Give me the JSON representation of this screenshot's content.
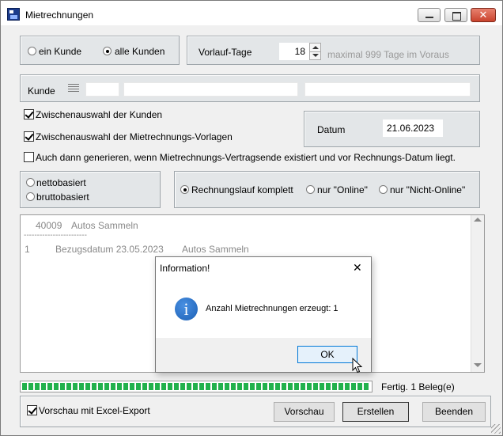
{
  "window": {
    "title": "Mietrechnungen"
  },
  "customer_scope": {
    "option_one": "ein Kunde",
    "option_all": "alle Kunden",
    "selected": "alle Kunden"
  },
  "vorlauf": {
    "label": "Vorlauf-Tage",
    "value": "18",
    "hint": "maximal 999 Tage im Voraus"
  },
  "kunde": {
    "label": "Kunde"
  },
  "checks": {
    "zwischenauswahl_kunden": {
      "label": "Zwischenauswahl der Kunden",
      "checked": true
    },
    "zwischenauswahl_vorlagen": {
      "label": "Zwischenauswahl der Mietrechnungs-Vorlagen",
      "checked": true
    },
    "auch_dann": {
      "label": "Auch dann generieren, wenn Mietrechnungs-Vertragsende existiert und vor Rechnungs-Datum liegt.",
      "checked": false
    }
  },
  "datum": {
    "label": "Datum",
    "value": "21.06.2023"
  },
  "basis": {
    "netto": "nettobasiert",
    "brutto": "bruttobasiert"
  },
  "rechnungslauf": {
    "komplett": "Rechnungslauf komplett",
    "online": "nur \"Online\"",
    "nicht_online": "nur \"Nicht-Online\"",
    "selected": "komplett"
  },
  "log": {
    "line1_num": "40009",
    "line1_name": "Autos Sammeln",
    "separator": "------------------------",
    "line2_num": "1",
    "line2_date": "Bezugsdatum 23.05.2023",
    "line2_name": "Autos Sammeln"
  },
  "dialog": {
    "title": "Information!",
    "message": "Anzahl Mietrechnungen erzeugt: 1",
    "ok": "OK",
    "close": "✕"
  },
  "status": {
    "text": "Fertig. 1 Beleg(e)",
    "progress": 1.0
  },
  "footer": {
    "preview_check": {
      "label": "Vorschau mit Excel-Export",
      "checked": true
    },
    "vorschau": "Vorschau",
    "erstellen": "Erstellen",
    "beenden": "Beenden"
  },
  "colors": {
    "progress_green": "#22b14c",
    "focus_blue": "#0078d7"
  }
}
